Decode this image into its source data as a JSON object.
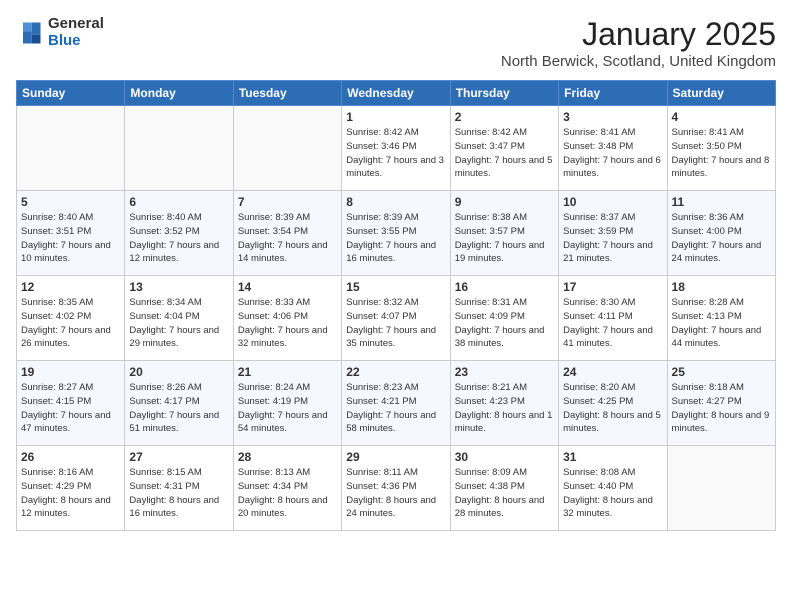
{
  "logo": {
    "general": "General",
    "blue": "Blue"
  },
  "title": "January 2025",
  "location": "North Berwick, Scotland, United Kingdom",
  "days_of_week": [
    "Sunday",
    "Monday",
    "Tuesday",
    "Wednesday",
    "Thursday",
    "Friday",
    "Saturday"
  ],
  "weeks": [
    [
      {
        "day": "",
        "info": ""
      },
      {
        "day": "",
        "info": ""
      },
      {
        "day": "",
        "info": ""
      },
      {
        "day": "1",
        "info": "Sunrise: 8:42 AM\nSunset: 3:46 PM\nDaylight: 7 hours\nand 3 minutes."
      },
      {
        "day": "2",
        "info": "Sunrise: 8:42 AM\nSunset: 3:47 PM\nDaylight: 7 hours\nand 5 minutes."
      },
      {
        "day": "3",
        "info": "Sunrise: 8:41 AM\nSunset: 3:48 PM\nDaylight: 7 hours\nand 6 minutes."
      },
      {
        "day": "4",
        "info": "Sunrise: 8:41 AM\nSunset: 3:50 PM\nDaylight: 7 hours\nand 8 minutes."
      }
    ],
    [
      {
        "day": "5",
        "info": "Sunrise: 8:40 AM\nSunset: 3:51 PM\nDaylight: 7 hours\nand 10 minutes."
      },
      {
        "day": "6",
        "info": "Sunrise: 8:40 AM\nSunset: 3:52 PM\nDaylight: 7 hours\nand 12 minutes."
      },
      {
        "day": "7",
        "info": "Sunrise: 8:39 AM\nSunset: 3:54 PM\nDaylight: 7 hours\nand 14 minutes."
      },
      {
        "day": "8",
        "info": "Sunrise: 8:39 AM\nSunset: 3:55 PM\nDaylight: 7 hours\nand 16 minutes."
      },
      {
        "day": "9",
        "info": "Sunrise: 8:38 AM\nSunset: 3:57 PM\nDaylight: 7 hours\nand 19 minutes."
      },
      {
        "day": "10",
        "info": "Sunrise: 8:37 AM\nSunset: 3:59 PM\nDaylight: 7 hours\nand 21 minutes."
      },
      {
        "day": "11",
        "info": "Sunrise: 8:36 AM\nSunset: 4:00 PM\nDaylight: 7 hours\nand 24 minutes."
      }
    ],
    [
      {
        "day": "12",
        "info": "Sunrise: 8:35 AM\nSunset: 4:02 PM\nDaylight: 7 hours\nand 26 minutes."
      },
      {
        "day": "13",
        "info": "Sunrise: 8:34 AM\nSunset: 4:04 PM\nDaylight: 7 hours\nand 29 minutes."
      },
      {
        "day": "14",
        "info": "Sunrise: 8:33 AM\nSunset: 4:06 PM\nDaylight: 7 hours\nand 32 minutes."
      },
      {
        "day": "15",
        "info": "Sunrise: 8:32 AM\nSunset: 4:07 PM\nDaylight: 7 hours\nand 35 minutes."
      },
      {
        "day": "16",
        "info": "Sunrise: 8:31 AM\nSunset: 4:09 PM\nDaylight: 7 hours\nand 38 minutes."
      },
      {
        "day": "17",
        "info": "Sunrise: 8:30 AM\nSunset: 4:11 PM\nDaylight: 7 hours\nand 41 minutes."
      },
      {
        "day": "18",
        "info": "Sunrise: 8:28 AM\nSunset: 4:13 PM\nDaylight: 7 hours\nand 44 minutes."
      }
    ],
    [
      {
        "day": "19",
        "info": "Sunrise: 8:27 AM\nSunset: 4:15 PM\nDaylight: 7 hours\nand 47 minutes."
      },
      {
        "day": "20",
        "info": "Sunrise: 8:26 AM\nSunset: 4:17 PM\nDaylight: 7 hours\nand 51 minutes."
      },
      {
        "day": "21",
        "info": "Sunrise: 8:24 AM\nSunset: 4:19 PM\nDaylight: 7 hours\nand 54 minutes."
      },
      {
        "day": "22",
        "info": "Sunrise: 8:23 AM\nSunset: 4:21 PM\nDaylight: 7 hours\nand 58 minutes."
      },
      {
        "day": "23",
        "info": "Sunrise: 8:21 AM\nSunset: 4:23 PM\nDaylight: 8 hours\nand 1 minute."
      },
      {
        "day": "24",
        "info": "Sunrise: 8:20 AM\nSunset: 4:25 PM\nDaylight: 8 hours\nand 5 minutes."
      },
      {
        "day": "25",
        "info": "Sunrise: 8:18 AM\nSunset: 4:27 PM\nDaylight: 8 hours\nand 9 minutes."
      }
    ],
    [
      {
        "day": "26",
        "info": "Sunrise: 8:16 AM\nSunset: 4:29 PM\nDaylight: 8 hours\nand 12 minutes."
      },
      {
        "day": "27",
        "info": "Sunrise: 8:15 AM\nSunset: 4:31 PM\nDaylight: 8 hours\nand 16 minutes."
      },
      {
        "day": "28",
        "info": "Sunrise: 8:13 AM\nSunset: 4:34 PM\nDaylight: 8 hours\nand 20 minutes."
      },
      {
        "day": "29",
        "info": "Sunrise: 8:11 AM\nSunset: 4:36 PM\nDaylight: 8 hours\nand 24 minutes."
      },
      {
        "day": "30",
        "info": "Sunrise: 8:09 AM\nSunset: 4:38 PM\nDaylight: 8 hours\nand 28 minutes."
      },
      {
        "day": "31",
        "info": "Sunrise: 8:08 AM\nSunset: 4:40 PM\nDaylight: 8 hours\nand 32 minutes."
      },
      {
        "day": "",
        "info": ""
      }
    ]
  ]
}
